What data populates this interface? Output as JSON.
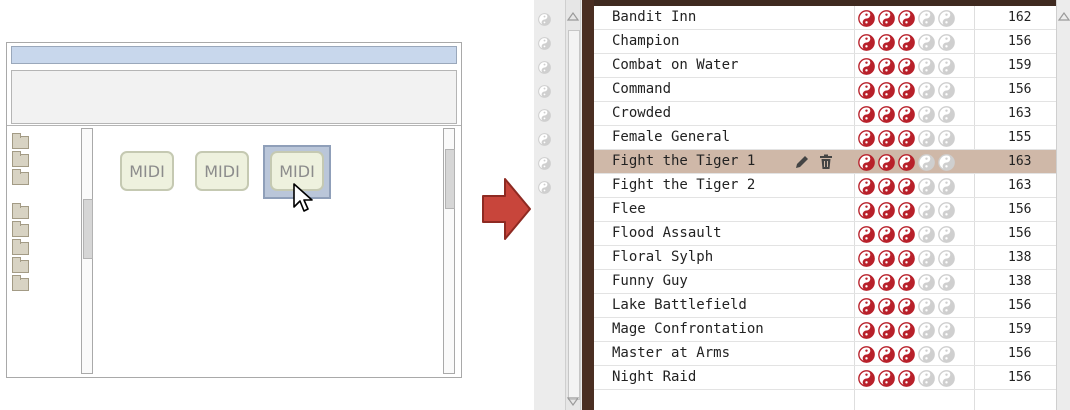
{
  "wireframe": {
    "midi_buttons": [
      "MIDI",
      "MIDI",
      "MIDI"
    ],
    "folder_count": 8
  },
  "songs": [
    {
      "name": "Bandit Inn",
      "tempo": "162",
      "rating": 3
    },
    {
      "name": "Champion",
      "tempo": "156",
      "rating": 3
    },
    {
      "name": "Combat on Water",
      "tempo": "159",
      "rating": 3
    },
    {
      "name": "Command",
      "tempo": "156",
      "rating": 3
    },
    {
      "name": "Crowded",
      "tempo": "163",
      "rating": 3
    },
    {
      "name": "Female General",
      "tempo": "155",
      "rating": 3
    },
    {
      "name": "Fight the Tiger 1",
      "tempo": "163",
      "rating": 3,
      "selected": true
    },
    {
      "name": "Fight the Tiger 2",
      "tempo": "163",
      "rating": 3
    },
    {
      "name": "Flee",
      "tempo": "156",
      "rating": 3
    },
    {
      "name": "Flood Assault",
      "tempo": "156",
      "rating": 3
    },
    {
      "name": "Floral Sylph",
      "tempo": "138",
      "rating": 3
    },
    {
      "name": "Funny Guy",
      "tempo": "138",
      "rating": 3
    },
    {
      "name": "Lake Battlefield",
      "tempo": "156",
      "rating": 3
    },
    {
      "name": "Mage Confrontation",
      "tempo": "159",
      "rating": 3
    },
    {
      "name": "Master at Arms",
      "tempo": "156",
      "rating": 3
    },
    {
      "name": "Night Raid",
      "tempo": "156",
      "rating": 3
    }
  ],
  "rating_max": 5,
  "colors": {
    "rating_on": "#b8202a",
    "rating_off": "#cfcfcf",
    "selected_row": "#cfb8a8",
    "arrow": "#c8453b"
  },
  "icons": {
    "edit": "pencil-icon",
    "delete": "trash-icon",
    "rating": "yin-yang-icon",
    "arrow": "right-arrow-icon"
  }
}
